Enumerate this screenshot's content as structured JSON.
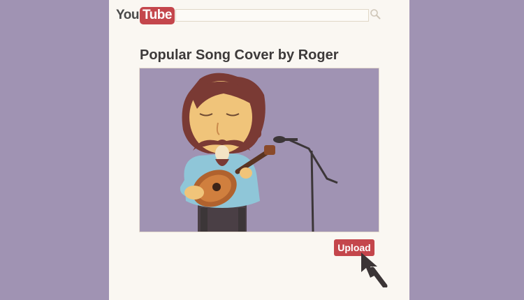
{
  "header": {
    "logo_you": "You",
    "logo_tube": "Tube",
    "search_value": ""
  },
  "video": {
    "title": "Popular Song Cover by Roger"
  },
  "actions": {
    "upload_label": "Upload"
  },
  "icons": {
    "search": "search-icon",
    "cursor": "mouse-pointer-icon"
  },
  "colors": {
    "background": "#a093b3",
    "page": "#faf7f2",
    "brand_red": "#c4464c",
    "video_bg": "#a093b3"
  }
}
